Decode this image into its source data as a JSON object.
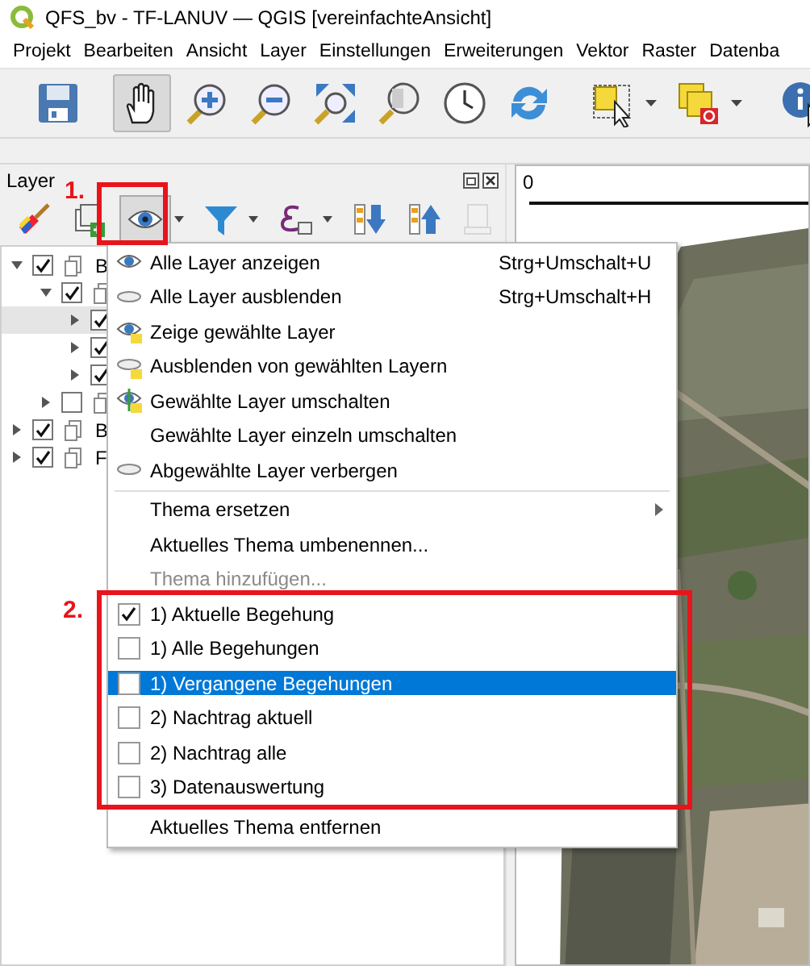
{
  "window": {
    "title": "QFS_bv - TF-LANUV — QGIS [vereinfachteAnsicht]"
  },
  "menu_bar": [
    "Projekt",
    "Bearbeiten",
    "Ansicht",
    "Layer",
    "Einstellungen",
    "Erweiterungen",
    "Vektor",
    "Raster",
    "Datenba"
  ],
  "toolbar": [
    {
      "pressed": false,
      "dropdown": false
    },
    {
      "pressed": true,
      "dropdown": false
    },
    {
      "pressed": false,
      "dropdown": false
    },
    {
      "pressed": false,
      "dropdown": false
    },
    {
      "pressed": false,
      "dropdown": false
    },
    {
      "pressed": false,
      "dropdown": false
    },
    {
      "pressed": false,
      "dropdown": false
    },
    {
      "pressed": false,
      "dropdown": false
    },
    {
      "pressed": false,
      "dropdown": true
    },
    {
      "pressed": false,
      "dropdown": true
    },
    {
      "pressed": false,
      "dropdown": false
    }
  ],
  "layers_panel": {
    "title": "Layer",
    "toolbar": [
      {
        "pressed": false,
        "dropdown": false,
        "disabled": false
      },
      {
        "pressed": false,
        "dropdown": false,
        "disabled": false
      },
      {
        "pressed": true,
        "dropdown": true,
        "disabled": false
      },
      {
        "pressed": false,
        "dropdown": true,
        "disabled": false
      },
      {
        "pressed": false,
        "dropdown": true,
        "disabled": false
      },
      {
        "pressed": false,
        "dropdown": false,
        "disabled": false
      },
      {
        "pressed": false,
        "dropdown": false,
        "disabled": false
      },
      {
        "pressed": false,
        "dropdown": false,
        "disabled": true
      }
    ],
    "tree": [
      {
        "label": "B",
        "checked": true,
        "expanded": true,
        "selected": false,
        "children": [
          {
            "checked": true,
            "expanded": true,
            "selected": false,
            "children": [
              {
                "checked": true,
                "expanded": false,
                "selected": true
              },
              {
                "checked": true,
                "expanded": false,
                "selected": false
              },
              {
                "checked": true,
                "expanded": false,
                "selected": false
              }
            ]
          },
          {
            "checked": false,
            "expanded": false,
            "selected": false
          }
        ]
      },
      {
        "label": "B",
        "checked": true,
        "expanded": false,
        "selected": false
      },
      {
        "label": "F",
        "checked": true,
        "expanded": false,
        "selected": false
      }
    ]
  },
  "theme_menu": [
    {
      "kind": "action",
      "label": "Alle Layer anzeigen",
      "shortcut": "Strg+Umschalt+U",
      "selected": false
    },
    {
      "kind": "action",
      "label": "Alle Layer ausblenden",
      "shortcut": "Strg+Umschalt+H",
      "selected": false
    },
    {
      "kind": "action",
      "label": "Zeige gewählte Layer",
      "selected": false
    },
    {
      "kind": "action",
      "label": "Ausblenden von gewählten Layern",
      "selected": false
    },
    {
      "kind": "action",
      "label": "Gewählte Layer umschalten",
      "selected": false
    },
    {
      "kind": "action",
      "label": "Gewählte Layer einzeln umschalten",
      "selected": false
    },
    {
      "kind": "action",
      "label": "Abgewählte Layer verbergen",
      "selected": false
    },
    {
      "kind": "separator"
    },
    {
      "kind": "submenu",
      "label": "Thema ersetzen",
      "selected": false
    },
    {
      "kind": "action",
      "label": "Aktuelles Thema umbenennen...",
      "selected": false
    },
    {
      "kind": "action",
      "label": "Thema hinzufügen...",
      "disabled": true,
      "selected": false
    },
    {
      "kind": "theme",
      "label": "1) Aktuelle Begehung",
      "checked": true,
      "selected": false
    },
    {
      "kind": "theme",
      "label": "1) Alle Begehungen",
      "checked": false,
      "selected": false
    },
    {
      "kind": "theme",
      "label": "1) Vergangene Begehungen",
      "checked": false,
      "selected": true
    },
    {
      "kind": "theme",
      "label": "2) Nachtrag aktuell",
      "checked": false,
      "selected": false
    },
    {
      "kind": "theme",
      "label": "2) Nachtrag alle",
      "checked": false,
      "selected": false
    },
    {
      "kind": "theme",
      "label": "3) Datenauswertung",
      "checked": false,
      "selected": false
    },
    {
      "kind": "separator"
    },
    {
      "kind": "action",
      "label": "Aktuelles Thema entfernen",
      "selected": false
    }
  ],
  "annotations": [
    {
      "label": "1."
    },
    {
      "label": "2."
    }
  ],
  "map": {
    "scale_label": "0"
  }
}
